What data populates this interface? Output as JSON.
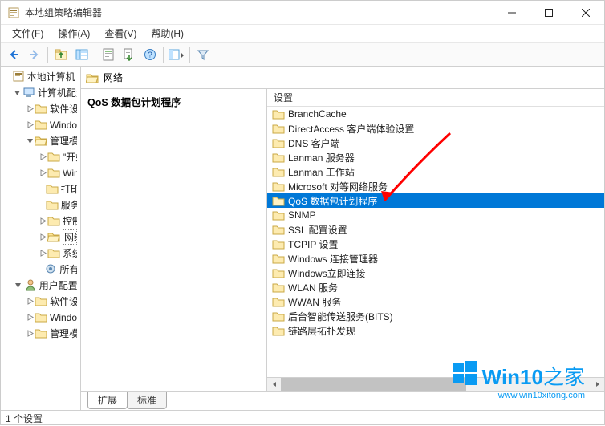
{
  "window": {
    "title": "本地组策略编辑器"
  },
  "menus": {
    "file": "文件(F)",
    "action": "操作(A)",
    "view": "查看(V)",
    "help": "帮助(H)"
  },
  "toolbar_icons": {
    "back": "back-icon",
    "forward": "forward-icon",
    "up": "up-icon",
    "show_hide": "show-hide-tree-icon",
    "properties": "properties-icon",
    "export": "export-list-icon",
    "help": "help-icon",
    "view_mode": "view-mode-icon",
    "filter": "filter-icon"
  },
  "tree": {
    "root": "本地计算机 策略",
    "computer_config": "计算机配置",
    "cc_software": "软件设置",
    "cc_windows": "Windows 设置",
    "cc_admin_templates": "管理模板",
    "at_start_menu": "\"开始\"菜单和",
    "at_windows_components": "Windows 组",
    "at_printers": "打印机",
    "at_server": "服务器",
    "at_control_panel": "控制面板",
    "at_network": "网络",
    "at_system": "系统",
    "at_all_settings": "所有设置",
    "user_config": "用户配置",
    "uc_software": "软件设置",
    "uc_windows": "Windows 设置",
    "uc_admin_templates": "管理模板"
  },
  "content": {
    "path_label": "网络",
    "heading": "QoS 数据包计划程序",
    "column_header": "设置",
    "items": [
      "BranchCache",
      "DirectAccess 客户端体验设置",
      "DNS 客户端",
      "Lanman 服务器",
      "Lanman 工作站",
      "Microsoft 对等网络服务",
      "QoS 数据包计划程序",
      "SNMP",
      "SSL 配置设置",
      "TCPIP 设置",
      "Windows 连接管理器",
      "Windows立即连接",
      "WLAN 服务",
      "WWAN 服务",
      "后台智能传送服务(BITS)",
      "链路层拓扑发现"
    ],
    "selected_index": 6
  },
  "tabs": {
    "extended": "扩展",
    "standard": "标准"
  },
  "statusbar": {
    "text": "1 个设置"
  },
  "watermark": {
    "brand": "Win10",
    "suffix": "之家",
    "url": "www.win10xitong.com"
  },
  "colors": {
    "selection": "#0078d7",
    "accent": "#0a9bf3",
    "arrow": "#ff0000"
  }
}
